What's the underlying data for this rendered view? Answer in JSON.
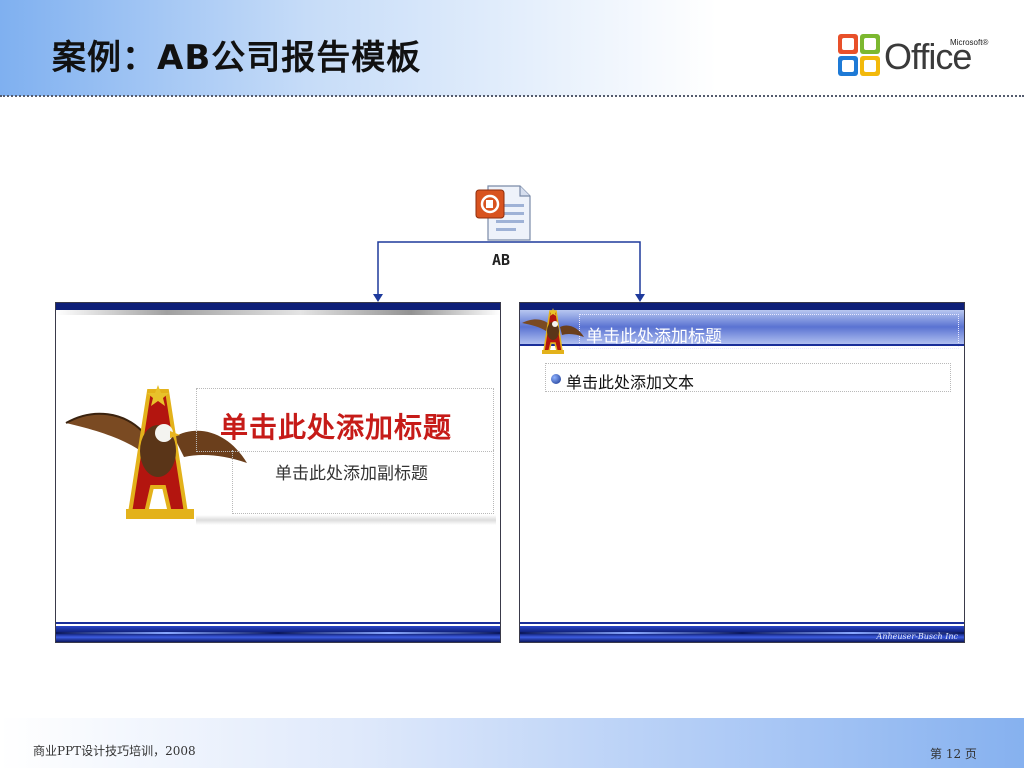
{
  "header": {
    "title": "案例：AB公司报告模板",
    "logo": {
      "brand": "Microsoft®",
      "word": "Office",
      "icon": "office-logo-icon"
    }
  },
  "file": {
    "label": "AB",
    "icon": "powerpoint-file-icon"
  },
  "slides": {
    "title_slide": {
      "title": "单击此处添加标题",
      "subtitle": "单击此处添加副标题",
      "emblem": "eagle-a-emblem-icon"
    },
    "content_slide": {
      "title": "单击此处添加标题",
      "bullet": "单击此处添加文本",
      "signature": "Anheuser-Busch Inc",
      "emblem": "eagle-a-emblem-icon"
    }
  },
  "footer": {
    "left": "商业PPT设计技巧培训，2008",
    "page": "第 12 页"
  },
  "colors": {
    "title_red": "#c61b18",
    "navy": "#0e1f78",
    "connector": "#1e3a9c"
  }
}
